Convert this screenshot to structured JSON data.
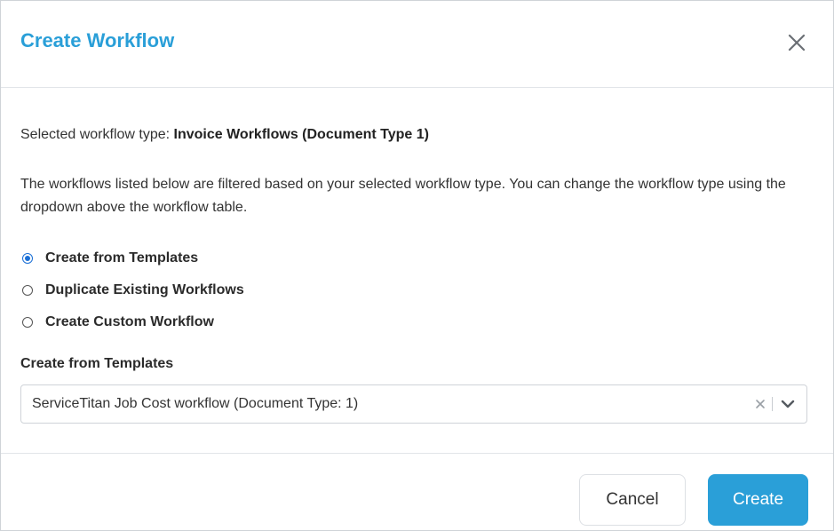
{
  "modal": {
    "title": "Create Workflow",
    "close_icon": "close-icon"
  },
  "body": {
    "selected_prefix": "Selected workflow type: ",
    "selected_value": "Invoice Workflows (Document Type 1)",
    "description": "The workflows listed below are filtered based on your selected workflow type. You can change the workflow type using the dropdown above the workflow table.",
    "options": [
      {
        "label": "Create from Templates",
        "checked": true
      },
      {
        "label": "Duplicate Existing Workflows",
        "checked": false
      },
      {
        "label": "Create Custom Workflow",
        "checked": false
      }
    ],
    "select_label": "Create from Templates",
    "select_value": "ServiceTitan Job Cost workflow (Document Type: 1)"
  },
  "footer": {
    "cancel_label": "Cancel",
    "create_label": "Create"
  },
  "colors": {
    "accent": "#2a9fd8",
    "radio_checked": "#1a6fd6"
  }
}
